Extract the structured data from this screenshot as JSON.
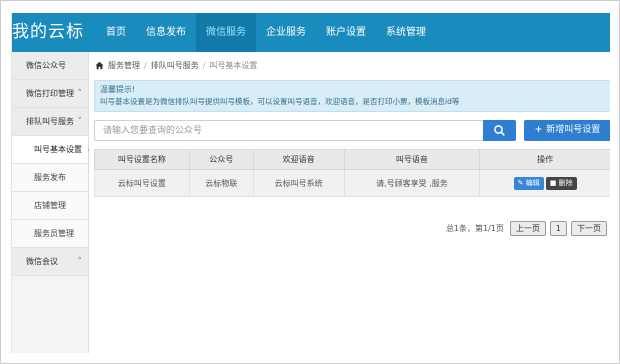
{
  "app": {
    "logo": "我的云标"
  },
  "nav": [
    {
      "label": "首页"
    },
    {
      "label": "信息发布"
    },
    {
      "label": "微信服务",
      "active": true
    },
    {
      "label": "企业服务"
    },
    {
      "label": "账户设置"
    },
    {
      "label": "系统管理"
    }
  ],
  "sidebar": {
    "items": [
      {
        "label": "微信公众号"
      },
      {
        "label": "微信打印管理"
      },
      {
        "label": "排队叫号服务"
      },
      {
        "label": "叫号基本设置"
      },
      {
        "label": "服务发布"
      },
      {
        "label": "店铺管理"
      },
      {
        "label": "服务员管理"
      },
      {
        "label": "微信会议"
      }
    ]
  },
  "breadcrumb": {
    "root": "服务管理",
    "mid": "排队叫号服务",
    "current": "叫号基本设置"
  },
  "notice": {
    "title": "温馨提示!",
    "text": "叫号基本设置是为微信排队叫号提供叫号模板，可以设置叫号语音，欢迎语音，是否打印小票，模板消息id等"
  },
  "search": {
    "placeholder": "请输入您要查询的公众号"
  },
  "add_button": {
    "label": "新增叫号设置"
  },
  "table": {
    "headers": [
      "叫号设置名称",
      "公众号",
      "欢迎语音",
      "叫号语音",
      "操作"
    ],
    "rows": [
      {
        "name": "云标叫号设置",
        "account": "云标物联",
        "welcome": "云标叫号系统",
        "call": "请,号顾客享受 ,服务"
      }
    ],
    "edit_label": "编辑",
    "delete_label": "删除"
  },
  "pager": {
    "summary": "总1条，第1/1页",
    "prev": "上一页",
    "page": "1",
    "next": "下一页"
  },
  "colors": {
    "nav": "#1a8bbd",
    "nav_active": "#117aa8",
    "primary": "#2e7fd1",
    "notice_bg": "#d9edf7",
    "notice_text": "#31708f"
  },
  "icons": {
    "home": "home-icon",
    "search": "search-icon",
    "edit": "edit-icon",
    "delete": "trash-icon"
  }
}
